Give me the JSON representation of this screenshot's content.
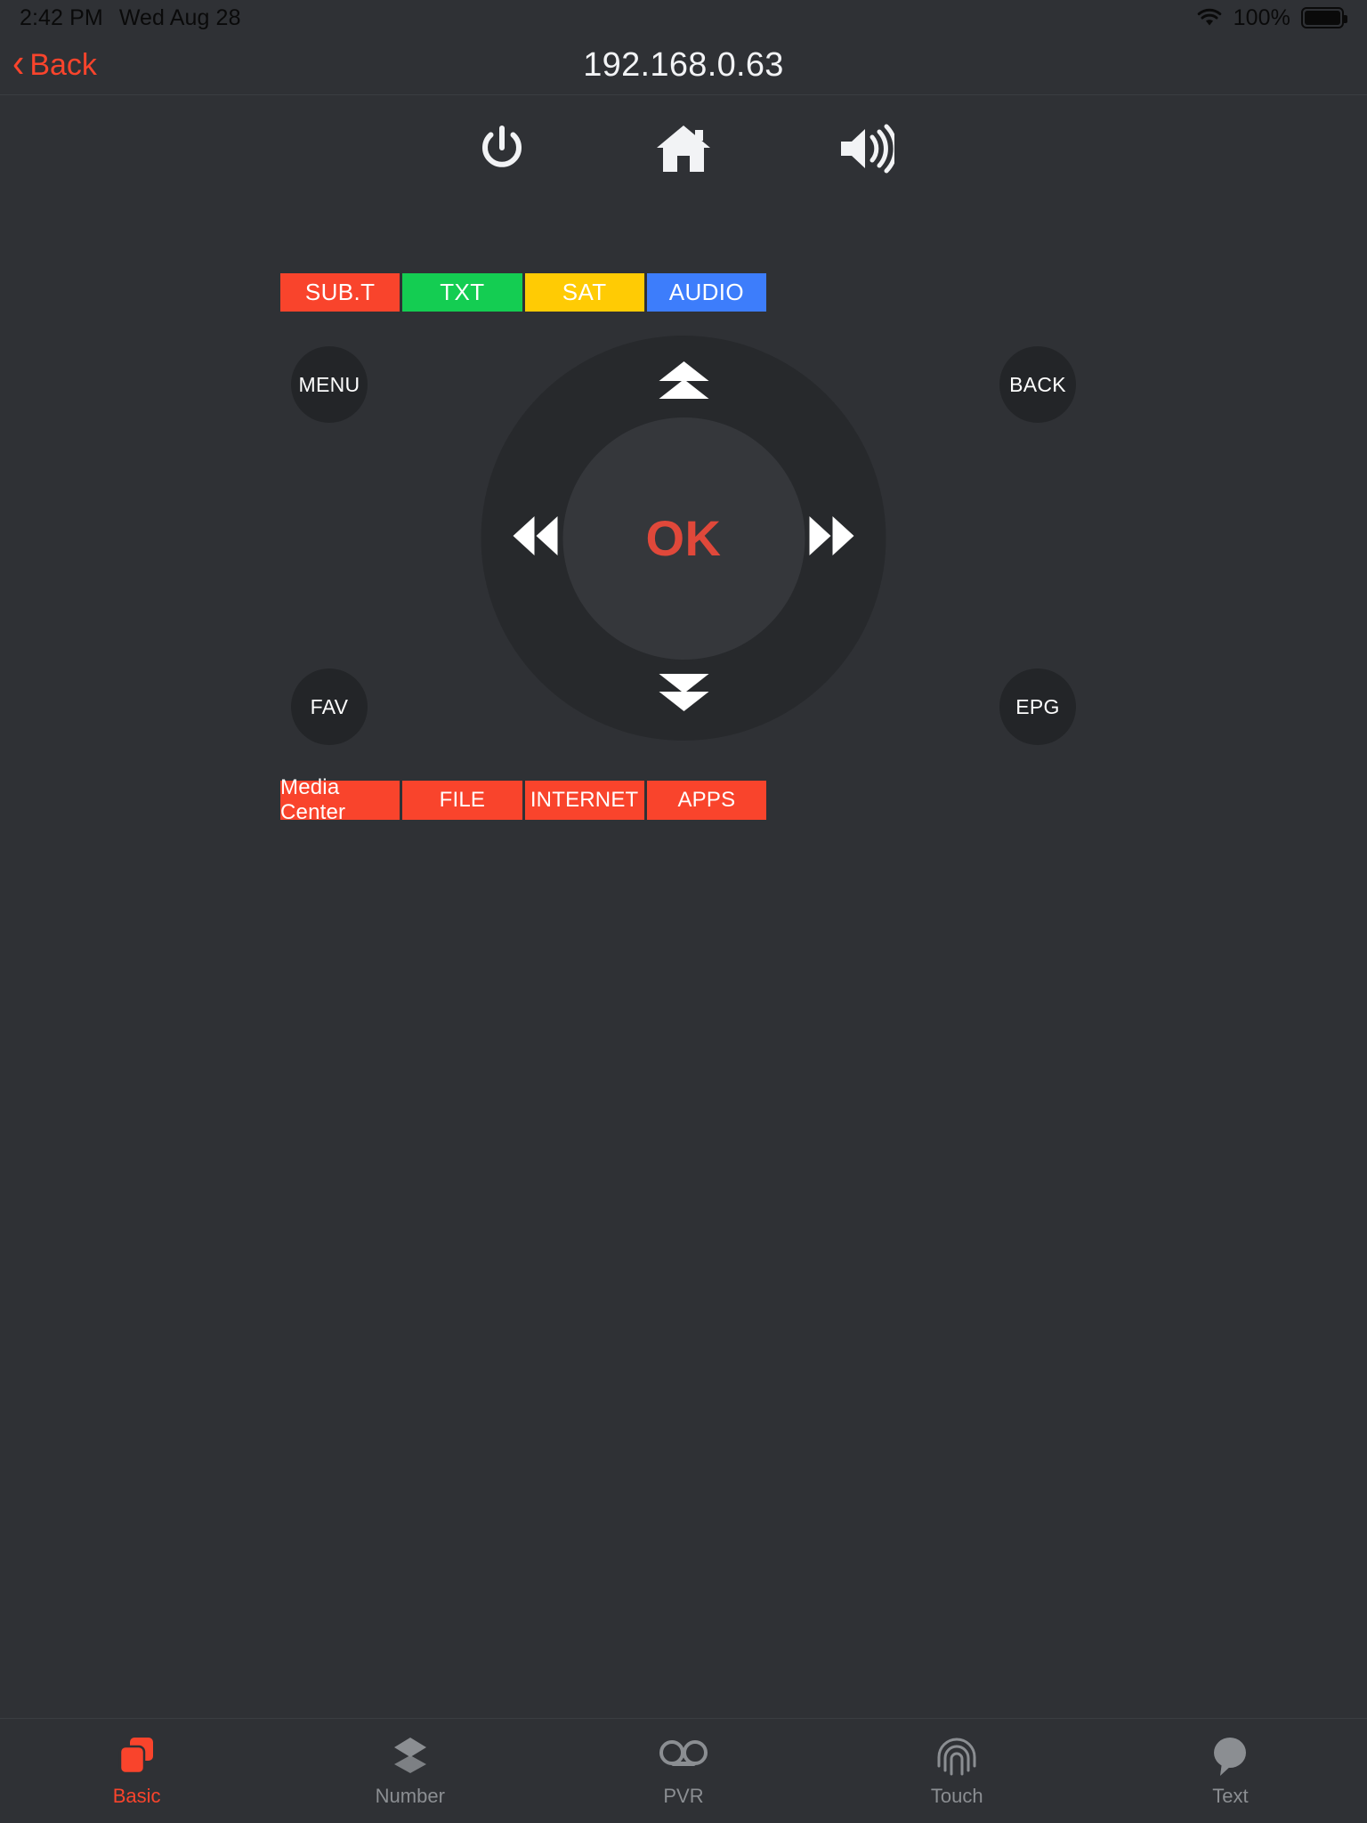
{
  "status_bar": {
    "time": "2:42 PM",
    "date": "Wed Aug 28",
    "battery_percent": "100%",
    "wifi_icon": "wifi-icon",
    "battery_icon": "battery-full-icon"
  },
  "nav": {
    "back_label": "Back",
    "back_chevron": "‹",
    "title": "192.168.0.63"
  },
  "top_icons": [
    {
      "name": "power-icon",
      "label": "Power"
    },
    {
      "name": "home-icon",
      "label": "Home"
    },
    {
      "name": "mute-icon",
      "label": "Mute"
    }
  ],
  "color_buttons": [
    {
      "label": "SUB.T",
      "color": "#f9442c"
    },
    {
      "label": "TXT",
      "color": "#14cd52"
    },
    {
      "label": "SAT",
      "color": "#ffcb04"
    },
    {
      "label": "AUDIO",
      "color": "#3d7dfb"
    }
  ],
  "dpad": {
    "ok_label": "OK",
    "ok_color": "#e0483a",
    "up_icon": "double-chevron-up-icon",
    "down_icon": "double-chevron-down-icon",
    "left_icon": "rewind-icon",
    "right_icon": "fast-forward-icon",
    "corners": [
      {
        "key": "menu",
        "label": "MENU"
      },
      {
        "key": "back",
        "label": "BACK"
      },
      {
        "key": "fav",
        "label": "FAV"
      },
      {
        "key": "epg",
        "label": "EPG"
      }
    ]
  },
  "app_buttons": [
    {
      "label": "Media Center"
    },
    {
      "label": "FILE"
    },
    {
      "label": "INTERNET"
    },
    {
      "label": "APPS"
    }
  ],
  "tabs": [
    {
      "label": "Basic",
      "icon": "stacked-squares-icon",
      "active": true
    },
    {
      "label": "Number",
      "icon": "layers-icon",
      "active": false
    },
    {
      "label": "PVR",
      "icon": "reels-icon",
      "active": false
    },
    {
      "label": "Touch",
      "icon": "fingerprint-icon",
      "active": false
    },
    {
      "label": "Text",
      "icon": "speech-bubble-icon",
      "active": false
    }
  ],
  "colors": {
    "background": "#2f3135",
    "accent": "#f9442c",
    "ring": "#27292c",
    "center": "#35373b",
    "corner": "#232528",
    "tab_inactive": "#8b8e92"
  }
}
